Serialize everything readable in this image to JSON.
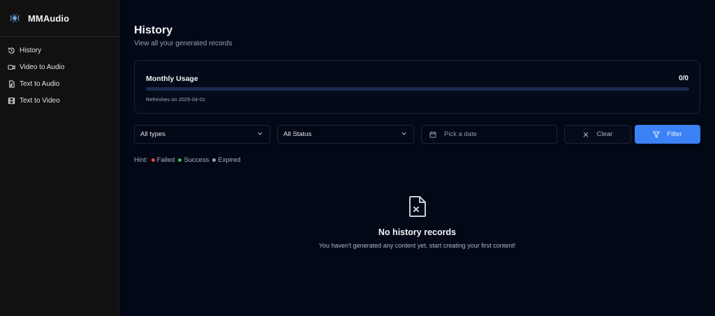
{
  "app": {
    "name": "MMAudio"
  },
  "sidebar": {
    "items": [
      {
        "label": "History",
        "icon": "history-icon"
      },
      {
        "label": "Video to Audio",
        "icon": "video-icon"
      },
      {
        "label": "Text to Audio",
        "icon": "audio-file-icon"
      },
      {
        "label": "Text to Video",
        "icon": "film-icon"
      }
    ]
  },
  "page": {
    "title": "History",
    "subtitle": "View all your generated records"
  },
  "usage": {
    "title": "Monthly Usage",
    "count": "0/0",
    "progress_fraction": 0,
    "refresh_text": "Refreshes on 2025-04-01"
  },
  "filters": {
    "type_select": "All types",
    "status_select": "All Status",
    "date_placeholder": "Pick a date",
    "clear_label": "Clear",
    "filter_label": "Filter"
  },
  "hint": {
    "label": "Hint:",
    "items": [
      {
        "label": "Failed",
        "color": "#ef4444"
      },
      {
        "label": "Success",
        "color": "#22c55e"
      },
      {
        "label": "Expired",
        "color": "#9ca3af"
      }
    ]
  },
  "empty": {
    "title": "No history records",
    "description": "You haven't generated any content yet, start creating your first content!"
  },
  "colors": {
    "accent": "#3b82f6",
    "background": "#030816",
    "sidebar": "#111111"
  }
}
